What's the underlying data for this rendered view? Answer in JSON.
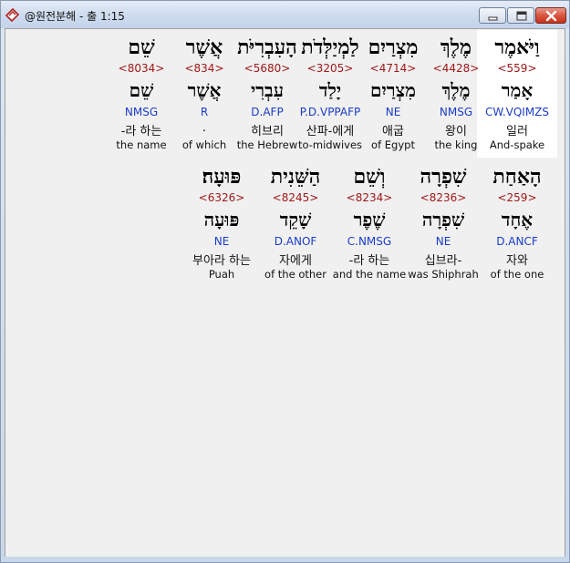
{
  "window": {
    "title": "@원전분해 - 출 1:15"
  },
  "colors": {
    "strong_number": "#a01818",
    "parsing": "#1a3cc9",
    "selected_background": "#ffffff"
  },
  "rows": [
    {
      "words": [
        {
          "hebrew": "וַיֹּאמֶר",
          "strong": "<559>",
          "lemma": "אָמַר",
          "parsing": "CW.VQIMZS",
          "korean": "일러",
          "english": "And-spake",
          "selected": true
        },
        {
          "hebrew": "מֶלֶךְ",
          "strong": "<4428>",
          "lemma": "מֶלֶךְ",
          "parsing": "NMSG",
          "korean": "왕이",
          "english": "the king",
          "selected": false
        },
        {
          "hebrew": "מִצְרַיִם",
          "strong": "<4714>",
          "lemma": "מִצְרַיִם",
          "parsing": "NE",
          "korean": "애굽",
          "english": "of Egypt",
          "selected": false
        },
        {
          "hebrew": "לַמְיַלְּדֹת",
          "strong": "<3205>",
          "lemma": "יָלַד",
          "parsing": "P.D.VPPAFP",
          "korean": "산파-에게",
          "english": "to-midwives",
          "selected": false
        },
        {
          "hebrew": "הָעִבְרִיֹּת",
          "strong": "<5680>",
          "lemma": "עִבְרִי",
          "parsing": "D.AFP",
          "korean": "히브리",
          "english": "the Hebrew",
          "selected": false
        },
        {
          "hebrew": "אֲשֶׁר",
          "strong": "<834>",
          "lemma": "אֲשֶׁר",
          "parsing": "R",
          "korean": ".",
          "english": "of which",
          "selected": false
        },
        {
          "hebrew": "שֵׁם",
          "strong": "<8034>",
          "lemma": "שֵׁם",
          "parsing": "NMSG",
          "korean": "-라 하는",
          "english": "the name",
          "selected": false
        }
      ]
    },
    {
      "words": [
        {
          "hebrew": "הָאַחַת",
          "strong": "<259>",
          "lemma": "אֶחָד",
          "parsing": "D.ANCF",
          "korean": "자와",
          "english": "of the one",
          "selected": false
        },
        {
          "hebrew": "שִׁפְרָה",
          "strong": "<8236>",
          "lemma": "שִׁפְרָה",
          "parsing": "NE",
          "korean": "십브라-",
          "english": "was Shiphrah",
          "selected": false
        },
        {
          "hebrew": "וְשֵׁם",
          "strong": "<8234>",
          "lemma": "שֶׁפֶר",
          "parsing": "C.NMSG",
          "korean": "-라 하는",
          "english": "and the name",
          "selected": false
        },
        {
          "hebrew": "הַשֵּׁנִית",
          "strong": "<8245>",
          "lemma": "שָׁקֵד",
          "parsing": "D.ANOF",
          "korean": "자에게",
          "english": "of the other",
          "selected": false
        },
        {
          "hebrew": "פּוּעָה׃",
          "strong": "<6326>",
          "lemma": "פּוּעָה",
          "parsing": "NE",
          "korean": "부아라 하는",
          "english": "Puah",
          "selected": false
        }
      ]
    }
  ]
}
